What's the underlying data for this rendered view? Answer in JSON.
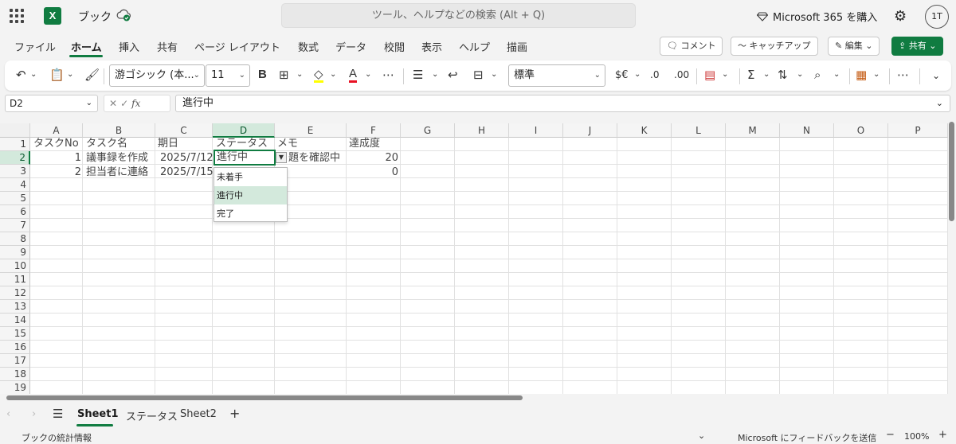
{
  "title_bar": {
    "doc_name": "ブック",
    "app_logo_letter": "X",
    "search_placeholder": "ツール、ヘルプなどの検索 (Alt + Q)",
    "buy_365": "Microsoft 365 を購入",
    "avatar": "1T"
  },
  "menu": {
    "tabs": [
      "ファイル",
      "ホーム",
      "挿入",
      "共有",
      "ページ レイアウト",
      "数式",
      "データ",
      "校閲",
      "表示",
      "ヘルプ",
      "描画"
    ],
    "active_tab": "ホーム",
    "comment_label": "コメント",
    "catchup_label": "キャッチアップ",
    "edit_label": "編集",
    "share_label": "共有"
  },
  "ribbon": {
    "font_name": "游ゴシック (本...",
    "font_size": "11",
    "bold_label": "B",
    "number_format": "標準",
    "currency_label": "$€"
  },
  "formula_bar": {
    "name_box": "D2",
    "fx_label": "fx",
    "content": "進行中"
  },
  "sheet": {
    "columns": [
      "A",
      "B",
      "C",
      "D",
      "E",
      "F",
      "G",
      "H",
      "I",
      "J",
      "K",
      "L",
      "M",
      "N",
      "O",
      "P"
    ],
    "selected_column": "D",
    "rows": [
      "1",
      "2",
      "3",
      "4",
      "5",
      "6",
      "7",
      "8",
      "9",
      "10",
      "11",
      "12",
      "13",
      "14",
      "15",
      "16",
      "17",
      "18",
      "19"
    ],
    "selected_row": "2",
    "cells": {
      "A1": "タスクNo",
      "B1": "タスク名",
      "C1": "期日",
      "D1": "ステータス",
      "E1": "メモ",
      "F1": "達成度",
      "A2": "1",
      "B2": "議事録を作成",
      "C2": "2025/7/12",
      "D2": "進行中",
      "E2": "題を確認中",
      "F2": "20",
      "A3": "2",
      "B3": "担当者に連絡",
      "C3": "2025/7/15",
      "F3": "0"
    },
    "dropdown_options": [
      "未着手",
      "進行中",
      "完了"
    ],
    "dropdown_selected": "進行中"
  },
  "sheet_tabs": {
    "tabs": [
      "Sheet1",
      "ステータス",
      "Sheet2"
    ],
    "active": "Sheet1"
  },
  "status_bar": {
    "left_text": "ブックの統計情報",
    "feedback": "Microsoft にフィードバックを送信",
    "zoom": "100%"
  },
  "colors": {
    "accent": "#107c41",
    "selection_fill": "#d3e9dc"
  }
}
